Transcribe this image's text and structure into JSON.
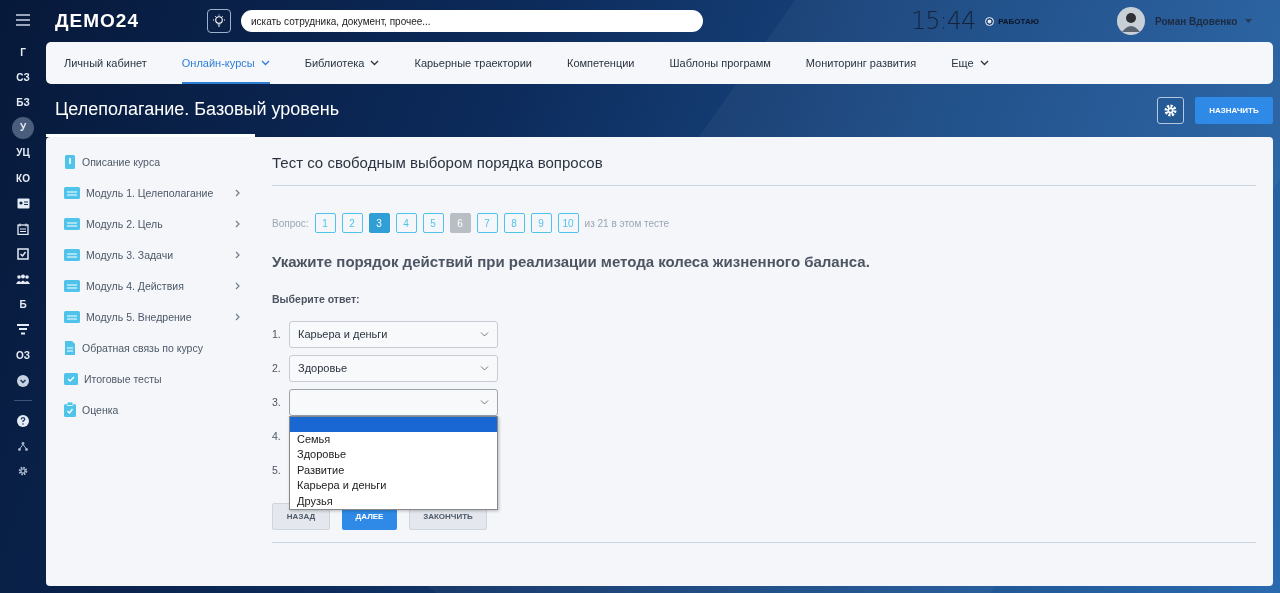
{
  "header": {
    "logo": "ДЕМО24",
    "search": {
      "placeholder": "искать сотрудника, документ, прочее..."
    },
    "clock": "15:44",
    "status": "РАБОТАЮ",
    "user": "Роман Вдовенко"
  },
  "rail": [
    {
      "kind": "text",
      "label": "Г",
      "selected": false
    },
    {
      "kind": "text",
      "label": "СЗ",
      "selected": false
    },
    {
      "kind": "text",
      "label": "БЗ",
      "selected": false
    },
    {
      "kind": "text",
      "label": "У",
      "selected": true
    },
    {
      "kind": "text",
      "label": "УЦ",
      "selected": false
    },
    {
      "kind": "text",
      "label": "КО",
      "selected": false
    },
    {
      "kind": "contact",
      "selected": false
    },
    {
      "kind": "calendar",
      "selected": false
    },
    {
      "kind": "task",
      "selected": false
    },
    {
      "kind": "people",
      "selected": false
    },
    {
      "kind": "text",
      "label": "Б",
      "selected": false
    },
    {
      "kind": "filter",
      "selected": false
    },
    {
      "kind": "text",
      "label": "ОЗ",
      "selected": false
    },
    {
      "kind": "more",
      "selected": false
    }
  ],
  "nav": [
    {
      "label": "Личный кабинет",
      "selected": false,
      "dropdown": false
    },
    {
      "label": "Онлайн-курсы",
      "selected": true,
      "dropdown": true
    },
    {
      "label": "Библиотека",
      "selected": false,
      "dropdown": true
    },
    {
      "label": "Карьерные траектории",
      "selected": false,
      "dropdown": false
    },
    {
      "label": "Компетенции",
      "selected": false,
      "dropdown": false
    },
    {
      "label": "Шаблоны программ",
      "selected": false,
      "dropdown": false
    },
    {
      "label": "Мониторинг развития",
      "selected": false,
      "dropdown": false
    },
    {
      "label": "Еще",
      "selected": false,
      "dropdown": true
    }
  ],
  "page_title": "Целеполагание. Базовый уровень",
  "assign_button": "НАЗНАЧИТЬ",
  "course_menu": [
    {
      "kind": "info",
      "label": "Описание курса",
      "expandable": false
    },
    {
      "kind": "module",
      "label": "Модуль 1. Целеполагание",
      "expandable": true
    },
    {
      "kind": "module",
      "label": "Модуль 2. Цель",
      "expandable": true
    },
    {
      "kind": "module",
      "label": "Модуль 3. Задачи",
      "expandable": true
    },
    {
      "kind": "module",
      "label": "Модуль 4. Действия",
      "expandable": true
    },
    {
      "kind": "module",
      "label": "Модуль 5. Внедрение",
      "expandable": true
    },
    {
      "kind": "document",
      "label": "Обратная связь по курсу",
      "expandable": false
    },
    {
      "kind": "tests",
      "label": "Итоговые тесты",
      "expandable": false
    },
    {
      "kind": "grade",
      "label": "Оценка",
      "expandable": false
    }
  ],
  "test": {
    "title": "Тест со свободным выбором порядка вопросов",
    "pager_label": "Вопрос:",
    "pages": [
      {
        "label": "1",
        "selected": false,
        "disabled": false
      },
      {
        "label": "2",
        "selected": false,
        "disabled": false
      },
      {
        "label": "3",
        "selected": true,
        "disabled": false
      },
      {
        "label": "4",
        "selected": false,
        "disabled": false
      },
      {
        "label": "5",
        "selected": false,
        "disabled": false
      },
      {
        "label": "6",
        "selected": false,
        "disabled": true
      },
      {
        "label": "7",
        "selected": false,
        "disabled": false
      },
      {
        "label": "8",
        "selected": false,
        "disabled": false
      },
      {
        "label": "9",
        "selected": false,
        "disabled": false
      },
      {
        "label": "10",
        "selected": false,
        "disabled": false
      }
    ],
    "pager_total": "из 21 в этом тесте",
    "question": "Укажите порядок действий при реализации метода колеса жизненного баланса.",
    "answer_label": "Выберите ответ:",
    "answers": [
      {
        "number": "1.",
        "value": "Карьера и деньги",
        "expanded": false
      },
      {
        "number": "2.",
        "value": "Здоровье",
        "expanded": false
      },
      {
        "number": "3.",
        "expanded": true,
        "blank_highlighted": true,
        "options": [
          "Семья",
          "Здоровье",
          "Развитие",
          "Карьера и деньги",
          "Друзья"
        ]
      },
      {
        "number": "4.",
        "hidden": true
      },
      {
        "number": "5.",
        "hidden": true
      }
    ],
    "buttons": {
      "back": "НАЗАД",
      "next": "ДАЛЕЕ",
      "finish": "ЗАКОНЧИТЬ"
    }
  }
}
